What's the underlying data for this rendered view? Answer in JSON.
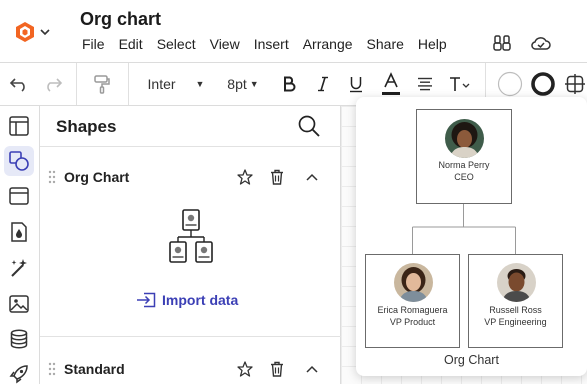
{
  "document": {
    "title": "Org chart"
  },
  "menu": [
    "File",
    "Edit",
    "Select",
    "View",
    "Insert",
    "Arrange",
    "Share",
    "Help"
  ],
  "toolbar": {
    "font": "Inter",
    "font_size": "8pt",
    "text_color": "#1f1f1f"
  },
  "panel": {
    "title": "Shapes",
    "sections": [
      {
        "title": "Org Chart",
        "import_label": "Import data",
        "expanded": true
      },
      {
        "title": "Standard",
        "expanded": true
      }
    ]
  },
  "preview": {
    "caption": "Org Chart",
    "people": [
      {
        "name": "Norma Perry",
        "role": "CEO"
      },
      {
        "name": "Erica Romaguera",
        "role": "VP Product"
      },
      {
        "name": "Russell Ross",
        "role": "VP Engineering"
      }
    ]
  },
  "colors": {
    "accent": "#3b3fb5",
    "brand_orange": "#f26522",
    "rail_active": "#e6e9f7"
  }
}
